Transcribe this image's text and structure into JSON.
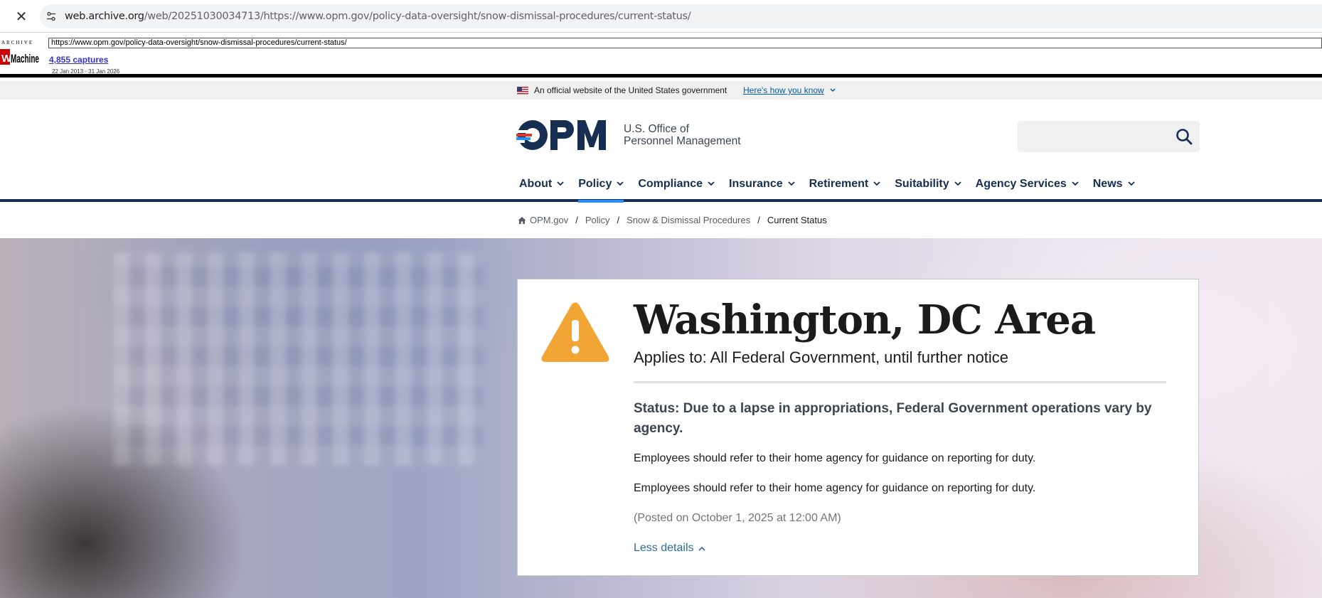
{
  "browser": {
    "url_host": "web.archive.org",
    "url_path": "/web/20251030034713/https://www.opm.gov/policy-data-oversight/snow-dismissal-procedures/current-status/"
  },
  "wayback": {
    "logo_top": "ARCHIVE",
    "logo_text": "WayBackMachine",
    "url_input": "https://www.opm.gov/policy-data-oversight/snow-dismissal-procedures/current-status/",
    "captures": "4,855 captures",
    "range": "22 Jan 2013 - 31 Jan 2026"
  },
  "gov_banner": {
    "text": "An official website of the United States government",
    "link": "Here's how you know"
  },
  "header": {
    "logo_text": "OPM",
    "agency_line1": "U.S. Office of",
    "agency_line2": "Personnel Management",
    "search_placeholder": ""
  },
  "nav": {
    "items": [
      {
        "label": "About",
        "active": false
      },
      {
        "label": "Policy",
        "active": true
      },
      {
        "label": "Compliance",
        "active": false
      },
      {
        "label": "Insurance",
        "active": false
      },
      {
        "label": "Retirement",
        "active": false
      },
      {
        "label": "Suitability",
        "active": false
      },
      {
        "label": "Agency Services",
        "active": false
      },
      {
        "label": "News",
        "active": false
      }
    ]
  },
  "breadcrumb": {
    "items": [
      "OPM.gov",
      "Policy",
      "Snow & Dismissal Procedures"
    ],
    "current": "Current Status"
  },
  "status": {
    "title": "Washington, DC Area",
    "applies_to": "Applies to: All Federal Government, until further notice",
    "status_text": "Status: Due to a lapse in appropriations, Federal Government operations vary by agency.",
    "guidance_1": "Employees should refer to their home agency for guidance on reporting for duty.",
    "guidance_2": "Employees should refer to their home agency for guidance on reporting for duty.",
    "posted": "(Posted on October 1, 2025 at 12:00 AM)",
    "less_details": "Less details"
  },
  "colors": {
    "navy": "#162e51",
    "accent_blue": "#2491ff",
    "warning_orange": "#f1a535",
    "link_blue": "#2c6ca3"
  }
}
